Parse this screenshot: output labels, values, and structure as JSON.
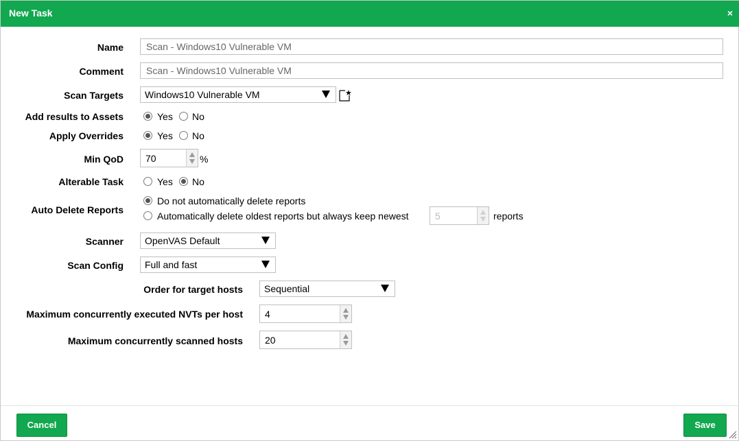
{
  "dialog": {
    "title": "New Task",
    "close_icon": "×"
  },
  "form": {
    "name": {
      "label": "Name",
      "value": "Scan - Windows10 Vulnerable VM"
    },
    "comment": {
      "label": "Comment",
      "value": "Scan - Windows10 Vulnerable VM"
    },
    "scan_targets": {
      "label": "Scan Targets",
      "selected": "Windows10 Vulnerable VM"
    },
    "add_results": {
      "label": "Add results to Assets",
      "yes": "Yes",
      "no": "No",
      "selected": "Yes"
    },
    "apply_overrides": {
      "label": "Apply Overrides",
      "yes": "Yes",
      "no": "No",
      "selected": "Yes"
    },
    "min_qod": {
      "label": "Min QoD",
      "value": "70",
      "unit": "%"
    },
    "alterable": {
      "label": "Alterable Task",
      "yes": "Yes",
      "no": "No",
      "selected": "No"
    },
    "auto_delete": {
      "label": "Auto Delete Reports",
      "option_none": "Do not automatically delete reports",
      "option_keep": "Automatically delete oldest reports but always keep newest",
      "keep_value": "5",
      "keep_unit": "reports",
      "selected": "none"
    },
    "scanner": {
      "label": "Scanner",
      "selected": "OpenVAS Default"
    },
    "scan_config": {
      "label": "Scan Config",
      "selected": "Full and fast"
    },
    "order_hosts": {
      "label": "Order for target hosts",
      "selected": "Sequential"
    },
    "max_nvts": {
      "label": "Maximum concurrently executed NVTs per host",
      "value": "4"
    },
    "max_hosts": {
      "label": "Maximum concurrently scanned hosts",
      "value": "20"
    }
  },
  "footer": {
    "cancel_label": "Cancel",
    "save_label": "Save"
  },
  "colors": {
    "accent": "#11a84f"
  }
}
